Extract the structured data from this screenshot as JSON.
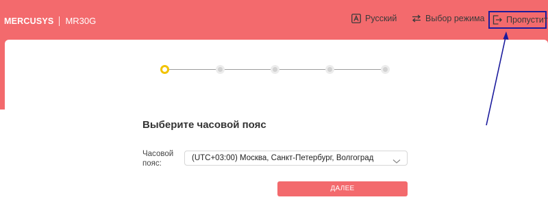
{
  "header": {
    "brand": "MERCUSYS",
    "model": "MR30G",
    "language_label": "Русский",
    "mode_label": "Выбор режима",
    "skip_label": "Пропустить"
  },
  "wizard": {
    "steps_total": 5,
    "current_step": 1,
    "title": "Выберите часовой пояс",
    "timezone_label": "Часовой пояс:",
    "timezone_value": "(UTC+03:00) Москва, Санкт-Петербург, Волгоград",
    "next_label": "ДАЛЕЕ"
  },
  "colors": {
    "brand": "#f36a6d",
    "active_step": "#f2c300",
    "annotation": "#1a1a9c"
  },
  "icons": [
    "language-icon",
    "mode-switch-icon",
    "skip-exit-icon",
    "chevron-down-icon"
  ]
}
